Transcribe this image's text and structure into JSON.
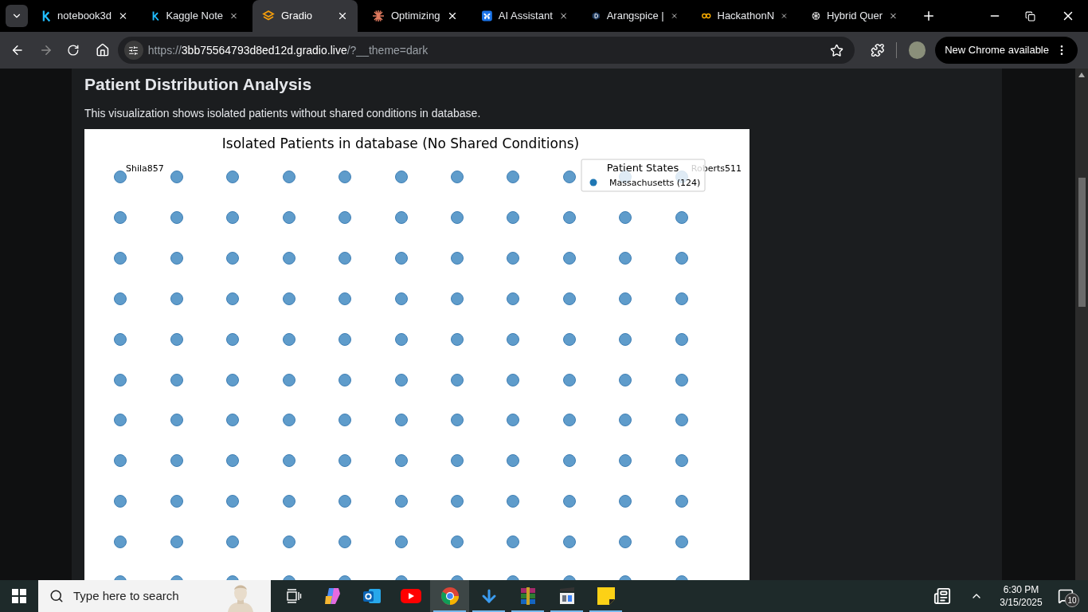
{
  "browser": {
    "tabs": [
      {
        "title": "notebook3d",
        "kind": "kaggle",
        "selected": false
      },
      {
        "title": "Kaggle Note",
        "kind": "kaggle",
        "selected": false
      },
      {
        "title": "Gradio",
        "kind": "gradio",
        "selected": true
      },
      {
        "title": "Optimizing",
        "kind": "burst",
        "selected": false
      },
      {
        "title": "AI Assistant",
        "kind": "butterfly",
        "selected": false
      },
      {
        "title": "Arangspice |",
        "kind": "hexagon",
        "selected": false
      },
      {
        "title": "HackathonN",
        "kind": "rings",
        "selected": false
      },
      {
        "title": "Hybrid Quer",
        "kind": "knot",
        "selected": false
      }
    ],
    "address": {
      "scheme": "https://",
      "host": "3bb75564793d8ed12d.gradio.live",
      "path": "/?__theme=dark"
    },
    "update_button": "New Chrome available"
  },
  "page": {
    "heading": "Patient Distribution Analysis",
    "description": "This visualization shows isolated patients without shared conditions in database.",
    "chart": {
      "title": "Isolated Patients in database (No Shared Conditions)",
      "first_point_label": "Shila857",
      "last_point_label": "Roberts511",
      "legend": {
        "title": "Patient States",
        "entries": [
          {
            "label": "Massachusetts (124)",
            "color": "#1f77b4"
          }
        ]
      }
    }
  },
  "taskbar": {
    "search_placeholder": "Type here to search",
    "apps": [
      {
        "kind": "task-view",
        "running": false,
        "selected": false
      },
      {
        "kind": "copilot",
        "running": false,
        "selected": false
      },
      {
        "kind": "outlook",
        "running": false,
        "selected": false
      },
      {
        "kind": "youtube",
        "running": false,
        "selected": false
      },
      {
        "kind": "chrome",
        "running": true,
        "selected": true
      },
      {
        "kind": "download",
        "running": true,
        "selected": false
      },
      {
        "kind": "archive",
        "running": true,
        "selected": false
      },
      {
        "kind": "clapper",
        "running": true,
        "selected": false
      },
      {
        "kind": "sticky-note",
        "running": true,
        "selected": false
      }
    ],
    "time": "6:30 PM",
    "date": "3/15/2025",
    "notification_count": "10"
  }
}
